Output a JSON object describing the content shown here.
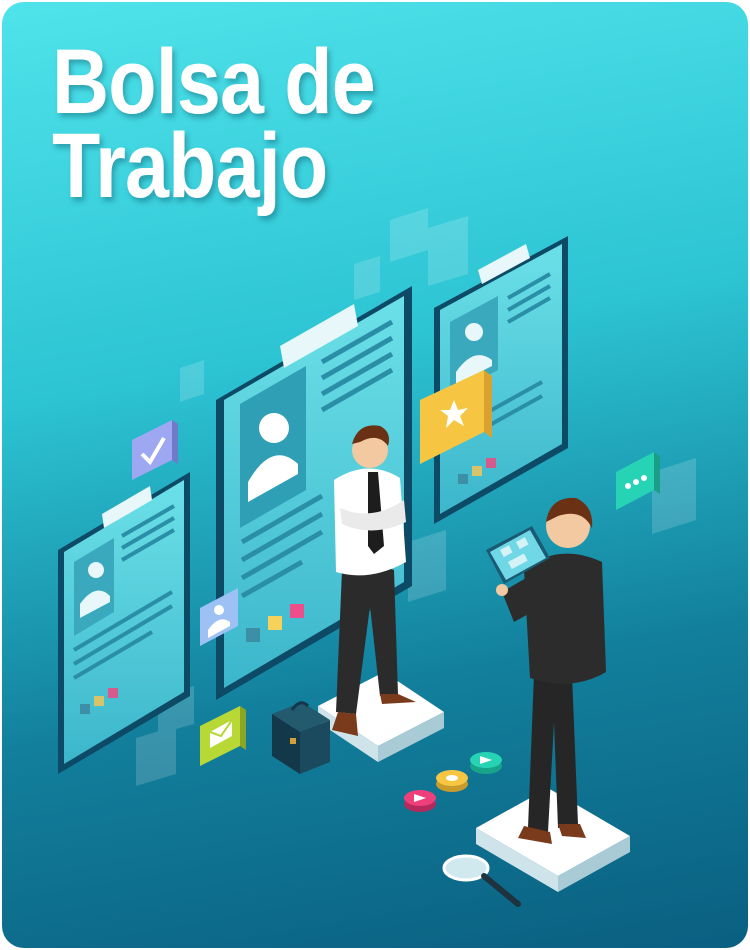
{
  "banner": {
    "title_line1": "Bolsa de",
    "title_line2": "Trabajo"
  },
  "colors": {
    "gradient": [
      "#4fe3ea",
      "#2cc3d3",
      "#127f9c",
      "#0a5f80"
    ],
    "panel": "#5ad0dc",
    "panel_dark": "#0d4a66",
    "accent_yellow": "#f6c643",
    "accent_pink": "#ee3f7a",
    "accent_green": "#26d3b4",
    "accent_lavender": "#9ea8f2"
  },
  "icons": [
    "checkmark-icon",
    "star-icon",
    "chat-bubble-icon",
    "user-profile-icon",
    "mail-icon",
    "briefcase-icon",
    "magnifying-glass-icon",
    "tablet-icon"
  ]
}
